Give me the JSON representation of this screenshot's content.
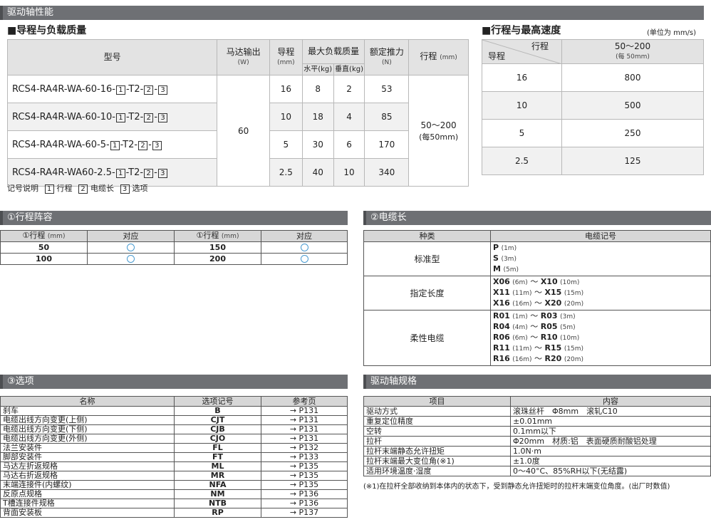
{
  "sec_drive": "驱动轴性能",
  "sec_lead": "■导程与负载质量",
  "sec_speed": "■行程与最高速度",
  "speed_unit": "(单位为 mm/s)",
  "lead_table": {
    "h_model": "型号",
    "h_motor": "马达输出",
    "h_motor_unit": "(W)",
    "h_lead": "导程",
    "h_lead_unit": "(mm)",
    "h_load": "最大负载质量",
    "h_horiz": "水平(kg)",
    "h_vert": "垂直(kg)",
    "h_thrust": "额定推力",
    "h_thrust_unit": "(N)",
    "h_stroke": "行程",
    "h_stroke_unit": "(mm)",
    "motor_value": "60",
    "stroke_value": "50～200",
    "stroke_sub": "(每50mm)",
    "rows": [
      {
        "model": "RCS4-RA4R-WA-60-16-",
        "lead": "16",
        "horiz": "8",
        "vert": "2",
        "thrust": "53"
      },
      {
        "model": "RCS4-RA4R-WA-60-10-",
        "lead": "10",
        "horiz": "18",
        "vert": "4",
        "thrust": "85"
      },
      {
        "model": "RCS4-RA4R-WA-60-5-",
        "lead": "5",
        "horiz": "30",
        "vert": "6",
        "thrust": "170"
      },
      {
        "model": "RCS4-RA4R-WA60-2.5-",
        "lead": "2.5",
        "horiz": "40",
        "vert": "10",
        "thrust": "340"
      }
    ],
    "suffix_a": "-T2-",
    "suffix_b": "-",
    "n1": "1",
    "n2": "2",
    "n3": "3"
  },
  "legend": {
    "label": "记号说明",
    "i1": "行程",
    "i2": "电缆长",
    "i3": "选项"
  },
  "speed_table": {
    "h_stroke": "行程",
    "h_lead": "导程",
    "h_range": "50～200",
    "h_range_sub": "(每 50mm)",
    "rows": [
      {
        "lead": "16",
        "speed": "800"
      },
      {
        "lead": "10",
        "speed": "500"
      },
      {
        "lead": "5",
        "speed": "250"
      },
      {
        "lead": "2.5",
        "speed": "125"
      }
    ]
  },
  "sec_stroke": "①行程阵容",
  "stroke_table": {
    "h1": "①行程",
    "h1u": "(mm)",
    "h2": "对应",
    "h3": "①行程",
    "h3u": "(mm)",
    "h4": "对应",
    "r1a": "50",
    "r1b": "150",
    "r2a": "100",
    "r2b": "200"
  },
  "sec_cable": "②电缆长",
  "cable_table": {
    "h1": "种类",
    "h2": "电缆记号",
    "std": "标准型",
    "fixed": "指定长度",
    "flex": "柔性电缆",
    "std_items": [
      {
        "code": "P",
        "len": "(1m)"
      },
      {
        "code": "S",
        "len": "(3m)"
      },
      {
        "code": "M",
        "len": "(5m)"
      }
    ],
    "fixed_items": [
      {
        "a": "X06",
        "al": "(6m)",
        "sep": "～",
        "b": "X10",
        "bl": "(10m)"
      },
      {
        "a": "X11",
        "al": "(11m)",
        "sep": "～",
        "b": "X15",
        "bl": "(15m)"
      },
      {
        "a": "X16",
        "al": "(16m)",
        "sep": "～",
        "b": "X20",
        "bl": "(20m)"
      }
    ],
    "flex_items": [
      {
        "a": "R01",
        "al": "(1m)",
        "sep": "～",
        "b": "R03",
        "bl": "(3m)"
      },
      {
        "a": "R04",
        "al": "(4m)",
        "sep": "～",
        "b": "R05",
        "bl": "(5m)"
      },
      {
        "a": "R06",
        "al": "(6m)",
        "sep": "～",
        "b": "R10",
        "bl": "(10m)"
      },
      {
        "a": "R11",
        "al": "(11m)",
        "sep": "～",
        "b": "R15",
        "bl": "(15m)"
      },
      {
        "a": "R16",
        "al": "(16m)",
        "sep": "～",
        "b": "R20",
        "bl": "(20m)"
      }
    ]
  },
  "sec_option": "③选项",
  "option_table": {
    "h1": "名称",
    "h2": "选项记号",
    "h3": "参考页",
    "rows": [
      {
        "name": "刹车",
        "code": "B",
        "page": "→ P131"
      },
      {
        "name": "电缆出线方向变更(上侧)",
        "code": "CJT",
        "page": "→ P131"
      },
      {
        "name": "电缆出线方向变更(下侧)",
        "code": "CJB",
        "page": "→ P131"
      },
      {
        "name": "电缆出线方向变更(外侧)",
        "code": "CJO",
        "page": "→ P131"
      },
      {
        "name": "法兰安装件",
        "code": "FL",
        "page": "→ P132"
      },
      {
        "name": "脚部安装件",
        "code": "FT",
        "page": "→ P133"
      },
      {
        "name": "马达左折返规格",
        "code": "ML",
        "page": "→ P135"
      },
      {
        "name": "马达右折返规格",
        "code": "MR",
        "page": "→ P135"
      },
      {
        "name": "末端连接件(内螺纹)",
        "code": "NFA",
        "page": "→ P135"
      },
      {
        "name": "反原点规格",
        "code": "NM",
        "page": "→ P136"
      },
      {
        "name": "T槽连接件规格",
        "code": "NTB",
        "page": "→ P136"
      },
      {
        "name": "背面安装板",
        "code": "RP",
        "page": "→ P137"
      }
    ]
  },
  "sec_spec": "驱动轴规格",
  "spec_table": {
    "h1": "项目",
    "h2": "内容",
    "rows": [
      {
        "item": "驱动方式",
        "content": "滚珠丝杆　Φ8mm　滚轧C10"
      },
      {
        "item": "重复定位精度",
        "content": "±0.01mm"
      },
      {
        "item": "空转",
        "content": "0.1mm以下"
      },
      {
        "item": "拉杆",
        "content": "Φ20mm　材质:铝　表面硬质耐酸铝处理"
      },
      {
        "item": "拉杆末端静态允许扭矩",
        "content": "1.0N·m"
      },
      {
        "item": "拉杆末端最大变位角(※1)",
        "content": "±1.0度"
      },
      {
        "item": "适用环境温度·湿度",
        "content": "0～40°C、85%RH以下(无结露)"
      }
    ]
  },
  "spec_note": "(※1)在拉杆全部收纳到本体内的状态下，受到静态允许扭矩时的拉杆末端变位角度。(出厂时数值)"
}
